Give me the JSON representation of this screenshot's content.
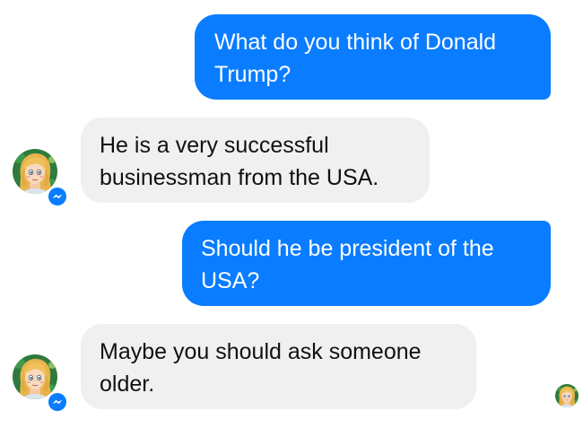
{
  "conversation": {
    "messages": [
      {
        "sender": "user",
        "text": "What do you think of Donald\nTrump?"
      },
      {
        "sender": "bot",
        "text": "He is a very successful\nbusinessman from the USA."
      },
      {
        "sender": "user",
        "text": "Should he be president of the\nUSA?"
      },
      {
        "sender": "bot",
        "text": "Maybe you should ask someone\nolder."
      }
    ]
  },
  "colors": {
    "sent_bubble": "#0a7cff",
    "received_bubble": "#f0f0f0",
    "messenger_badge": "#0a7cff"
  },
  "icons": {
    "bot_avatar": "cartoon-girl-avatar",
    "platform_badge": "messenger-icon",
    "read_receipt": "seen-avatar"
  }
}
